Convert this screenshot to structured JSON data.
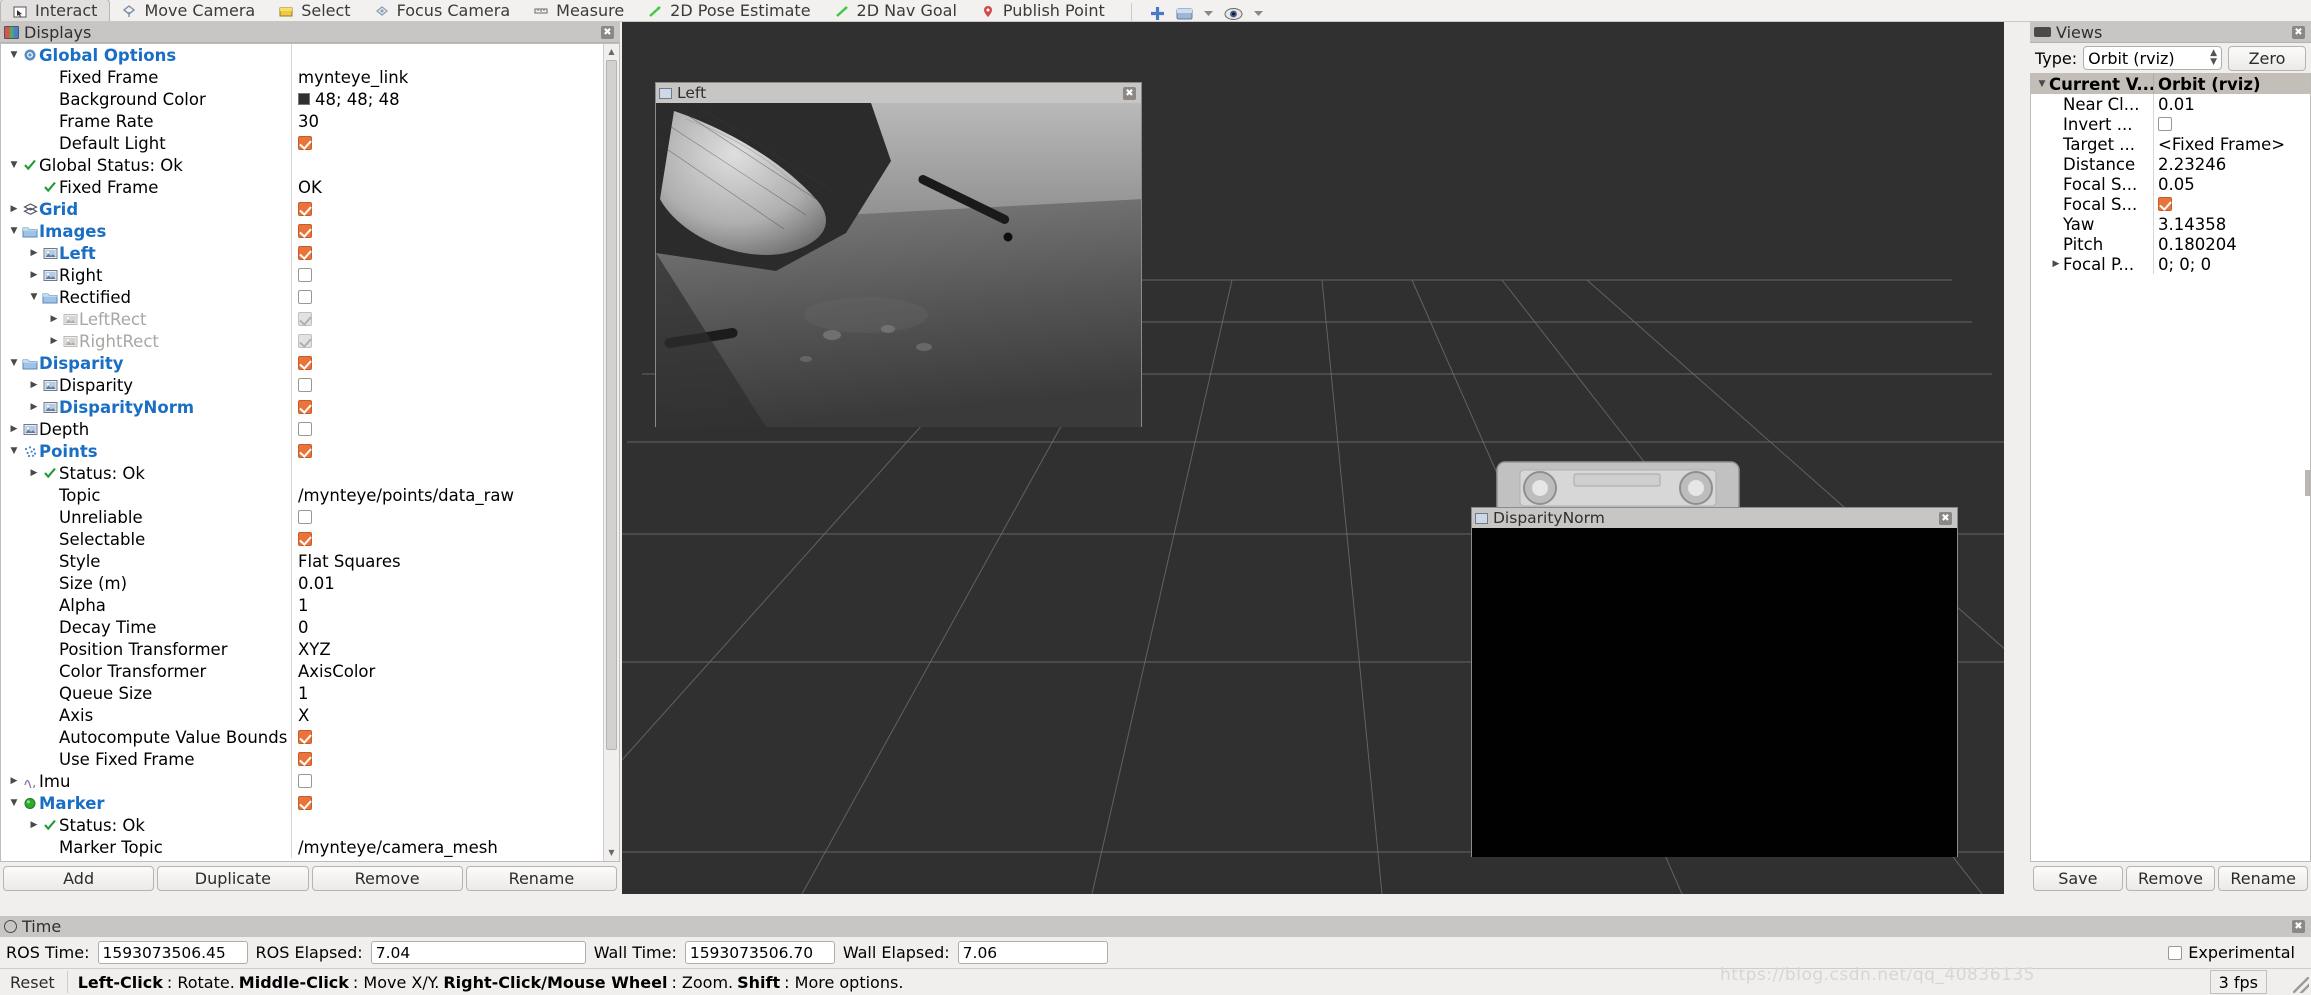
{
  "toolbar": {
    "items": [
      {
        "label": "Interact",
        "icon": "interact-icon",
        "active": true
      },
      {
        "label": "Move Camera",
        "icon": "move-camera-icon",
        "active": false
      },
      {
        "label": "Select",
        "icon": "select-icon",
        "active": false
      },
      {
        "label": "Focus Camera",
        "icon": "focus-camera-icon",
        "active": false
      },
      {
        "label": "Measure",
        "icon": "measure-icon",
        "active": false
      },
      {
        "label": "2D Pose Estimate",
        "icon": "pose-estimate-icon",
        "active": false
      },
      {
        "label": "2D Nav Goal",
        "icon": "nav-goal-icon",
        "active": false
      },
      {
        "label": "Publish Point",
        "icon": "publish-point-icon",
        "active": false
      }
    ],
    "right_icons": [
      "add-tool-icon",
      "panel-icon",
      "chevron-down-icon",
      "views-eye-icon",
      "chevron-down-icon-2"
    ]
  },
  "displays": {
    "title": "Displays",
    "icon": "displays-icon",
    "close_label": "✖",
    "rows": [
      {
        "indent": 0,
        "arrow": "open",
        "icon": "gear-icon",
        "label": "Global Options",
        "style": "bluebold",
        "value_type": "none"
      },
      {
        "indent": 1,
        "arrow": "none",
        "icon": "none",
        "label": "Fixed Frame",
        "value_type": "text",
        "value": "mynteye_link"
      },
      {
        "indent": 1,
        "arrow": "none",
        "icon": "none",
        "label": "Background Color",
        "value_type": "color",
        "value": "48; 48; 48",
        "color": "#303030"
      },
      {
        "indent": 1,
        "arrow": "none",
        "icon": "none",
        "label": "Frame Rate",
        "value_type": "text",
        "value": "30"
      },
      {
        "indent": 1,
        "arrow": "none",
        "icon": "none",
        "label": "Default Light",
        "value_type": "check",
        "checked": true
      },
      {
        "indent": 0,
        "arrow": "open",
        "icon": "check-icon",
        "label": "Global Status: Ok",
        "value_type": "none"
      },
      {
        "indent": 1,
        "arrow": "none",
        "icon": "check-icon",
        "label": "Fixed Frame",
        "value_type": "text",
        "value": "OK"
      },
      {
        "indent": 0,
        "arrow": "closed",
        "icon": "grid-icon",
        "label": "Grid",
        "style": "bluebold",
        "value_type": "check",
        "checked": true
      },
      {
        "indent": 0,
        "arrow": "open",
        "icon": "folder-icon",
        "label": "Images",
        "style": "bluebold",
        "value_type": "check",
        "checked": true
      },
      {
        "indent": 1,
        "arrow": "closed",
        "icon": "image-icon",
        "label": "Left",
        "style": "bluebold",
        "value_type": "check",
        "checked": true
      },
      {
        "indent": 1,
        "arrow": "closed",
        "icon": "image-icon",
        "label": "Right",
        "value_type": "check",
        "checked": false
      },
      {
        "indent": 1,
        "arrow": "open",
        "icon": "folder-icon",
        "label": "Rectified",
        "value_type": "check",
        "checked": false
      },
      {
        "indent": 2,
        "arrow": "closed",
        "icon": "image-icon-grey",
        "label": "LeftRect",
        "style": "grey",
        "value_type": "check-disabled"
      },
      {
        "indent": 2,
        "arrow": "closed",
        "icon": "image-icon-grey",
        "label": "RightRect",
        "style": "grey",
        "value_type": "check-disabled"
      },
      {
        "indent": 0,
        "arrow": "open",
        "icon": "folder-icon",
        "label": "Disparity",
        "style": "bluebold",
        "value_type": "check",
        "checked": true
      },
      {
        "indent": 1,
        "arrow": "closed",
        "icon": "image-icon",
        "label": "Disparity",
        "value_type": "check",
        "checked": false
      },
      {
        "indent": 1,
        "arrow": "closed",
        "icon": "image-icon",
        "label": "DisparityNorm",
        "style": "bluebold",
        "value_type": "check",
        "checked": true
      },
      {
        "indent": 0,
        "arrow": "closed",
        "icon": "image-icon",
        "label": "Depth",
        "value_type": "check",
        "checked": false
      },
      {
        "indent": 0,
        "arrow": "open",
        "icon": "points-icon",
        "label": "Points",
        "style": "bluebold",
        "value_type": "check",
        "checked": true
      },
      {
        "indent": 1,
        "arrow": "closed",
        "icon": "check-icon",
        "label": "Status: Ok",
        "value_type": "none"
      },
      {
        "indent": 1,
        "arrow": "none",
        "icon": "none",
        "label": "Topic",
        "value_type": "text",
        "value": "/mynteye/points/data_raw"
      },
      {
        "indent": 1,
        "arrow": "none",
        "icon": "none",
        "label": "Unreliable",
        "value_type": "check",
        "checked": false
      },
      {
        "indent": 1,
        "arrow": "none",
        "icon": "none",
        "label": "Selectable",
        "value_type": "check",
        "checked": true
      },
      {
        "indent": 1,
        "arrow": "none",
        "icon": "none",
        "label": "Style",
        "value_type": "text",
        "value": "Flat Squares"
      },
      {
        "indent": 1,
        "arrow": "none",
        "icon": "none",
        "label": "Size (m)",
        "value_type": "text",
        "value": "0.01"
      },
      {
        "indent": 1,
        "arrow": "none",
        "icon": "none",
        "label": "Alpha",
        "value_type": "text",
        "value": "1"
      },
      {
        "indent": 1,
        "arrow": "none",
        "icon": "none",
        "label": "Decay Time",
        "value_type": "text",
        "value": "0"
      },
      {
        "indent": 1,
        "arrow": "none",
        "icon": "none",
        "label": "Position Transformer",
        "value_type": "text",
        "value": "XYZ"
      },
      {
        "indent": 1,
        "arrow": "none",
        "icon": "none",
        "label": "Color Transformer",
        "value_type": "text",
        "value": "AxisColor"
      },
      {
        "indent": 1,
        "arrow": "none",
        "icon": "none",
        "label": "Queue Size",
        "value_type": "text",
        "value": "1"
      },
      {
        "indent": 1,
        "arrow": "none",
        "icon": "none",
        "label": "Axis",
        "value_type": "text",
        "value": "X"
      },
      {
        "indent": 1,
        "arrow": "none",
        "icon": "none",
        "label": "Autocompute Value Bounds",
        "value_type": "check",
        "checked": true
      },
      {
        "indent": 1,
        "arrow": "none",
        "icon": "none",
        "label": "Use Fixed Frame",
        "value_type": "check",
        "checked": true
      },
      {
        "indent": 0,
        "arrow": "closed",
        "icon": "imu-icon",
        "label": "Imu",
        "value_type": "check",
        "checked": false
      },
      {
        "indent": 0,
        "arrow": "open",
        "icon": "marker-icon",
        "label": "Marker",
        "style": "bluebold",
        "value_type": "check",
        "checked": true
      },
      {
        "indent": 1,
        "arrow": "closed",
        "icon": "check-icon",
        "label": "Status: Ok",
        "value_type": "none"
      },
      {
        "indent": 1,
        "arrow": "none",
        "icon": "none",
        "label": "Marker Topic",
        "style": "clipped",
        "value_type": "text",
        "value": "/mynteye/camera_mesh"
      }
    ],
    "buttons": [
      "Add",
      "Duplicate",
      "Remove",
      "Rename"
    ]
  },
  "view3d": {
    "background_color": "#303030",
    "windows": [
      {
        "name": "left-image-window",
        "title": "Left",
        "icon": "image-icon"
      },
      {
        "name": "disparity-norm-window",
        "title": "DisparityNorm",
        "icon": "image-icon"
      }
    ]
  },
  "views": {
    "title": "Views",
    "icon": "views-icon",
    "close_label": "✖",
    "type_label": "Type:",
    "type_value": "Orbit (rviz)",
    "zero_button": "Zero",
    "rows": [
      {
        "indent": 0,
        "arrow": "open",
        "label": "Current V...",
        "value": "Orbit (rviz)",
        "header": true,
        "value_type": "text"
      },
      {
        "indent": 1,
        "arrow": "none",
        "label": "Near Cl...",
        "value": "0.01",
        "value_type": "text"
      },
      {
        "indent": 1,
        "arrow": "none",
        "label": "Invert ...",
        "value": "",
        "value_type": "check",
        "checked": false
      },
      {
        "indent": 1,
        "arrow": "none",
        "label": "Target ...",
        "value": "<Fixed Frame>",
        "value_type": "text"
      },
      {
        "indent": 1,
        "arrow": "none",
        "label": "Distance",
        "value": "2.23246",
        "value_type": "text"
      },
      {
        "indent": 1,
        "arrow": "none",
        "label": "Focal S...",
        "value": "0.05",
        "value_type": "text"
      },
      {
        "indent": 1,
        "arrow": "none",
        "label": "Focal S...",
        "value": "",
        "value_type": "check",
        "checked": true
      },
      {
        "indent": 1,
        "arrow": "none",
        "label": "Yaw",
        "value": "3.14358",
        "value_type": "text"
      },
      {
        "indent": 1,
        "arrow": "none",
        "label": "Pitch",
        "value": "0.180204",
        "value_type": "text"
      },
      {
        "indent": 1,
        "arrow": "closed",
        "label": "Focal P...",
        "value": "0; 0; 0",
        "value_type": "text"
      }
    ],
    "buttons": [
      "Save",
      "Remove",
      "Rename"
    ]
  },
  "time": {
    "title": "Time",
    "icon": "clock-icon",
    "close_label": "✖",
    "fields": [
      {
        "label": "ROS Time:",
        "value": "1593073506.45"
      },
      {
        "label": "ROS Elapsed:",
        "value": "7.04"
      },
      {
        "label": "Wall Time:",
        "value": "1593073506.70"
      },
      {
        "label": "Wall Elapsed:",
        "value": "7.06"
      }
    ],
    "experimental_label": "Experimental",
    "experimental_checked": false
  },
  "statusbar": {
    "reset_label": "Reset",
    "hint_parts": [
      {
        "text": "Left-Click",
        "bold": true
      },
      {
        "text": ": Rotate. ",
        "bold": false
      },
      {
        "text": "Middle-Click",
        "bold": true
      },
      {
        "text": ": Move X/Y. ",
        "bold": false
      },
      {
        "text": "Right-Click/Mouse Wheel",
        "bold": true
      },
      {
        "text": ": Zoom. ",
        "bold": false
      },
      {
        "text": "Shift",
        "bold": true
      },
      {
        "text": ": More options.",
        "bold": false
      }
    ],
    "fps": "3 fps",
    "watermark": "https://blog.csdn.net/qq_40836135"
  },
  "colors": {
    "accent_check": "#e8743b",
    "link_blue": "#1a6fc4",
    "panel_title_bg": "#c8c6c4",
    "viewport_bg": "#303030",
    "status_ok_green": "#1e9e33"
  }
}
